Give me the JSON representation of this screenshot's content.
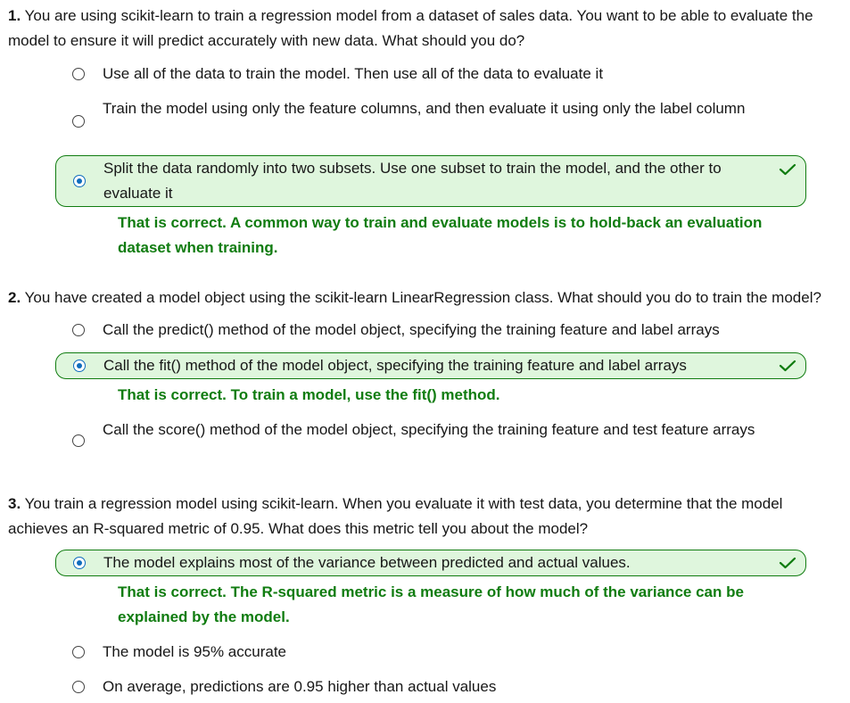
{
  "questions": [
    {
      "number": "1.",
      "text": "You are using scikit-learn to train a regression model from a dataset of sales data. You want to be able to evaluate the model to ensure it will predict accurately with new data. What should you do?",
      "options": [
        "Use all of the data to train the model. Then use all of the data to evaluate it",
        "Train the model using only the feature columns, and then evaluate it using only the label column",
        "Split the data randomly into two subsets. Use one subset to train the model, and the other to evaluate it"
      ],
      "selected_index": 2,
      "feedback": "That is correct. A common way to train and evaluate models is to hold-back an evaluation dataset when training."
    },
    {
      "number": "2.",
      "text": "You have created a model object using the scikit-learn LinearRegression class. What should you do to train the model?",
      "options": [
        "Call the predict() method of the model object, specifying the training feature and label arrays",
        "Call the fit() method of the model object, specifying the training feature and label arrays",
        "Call the score() method of the model object, specifying the training feature and test feature arrays"
      ],
      "selected_index": 1,
      "feedback": "That is correct. To train a model, use the fit() method."
    },
    {
      "number": "3.",
      "text": "You train a regression model using scikit-learn. When you evaluate it with test data, you determine that the model achieves an R-squared metric of 0.95. What does this metric tell you about the model?",
      "options": [
        "The model explains most of the variance between predicted and actual values.",
        "The model is 95% accurate",
        "On average, predictions are 0.95 higher than actual values"
      ],
      "selected_index": 0,
      "feedback": "That is correct. The R-squared metric is a measure of how much of the variance can be explained by the model."
    }
  ],
  "colors": {
    "correct": "#107c10",
    "selected_bg": "#dff6dd",
    "radio_selected": "#0f6cbd"
  },
  "icons": {
    "correct_mark": "checkmark-icon"
  }
}
